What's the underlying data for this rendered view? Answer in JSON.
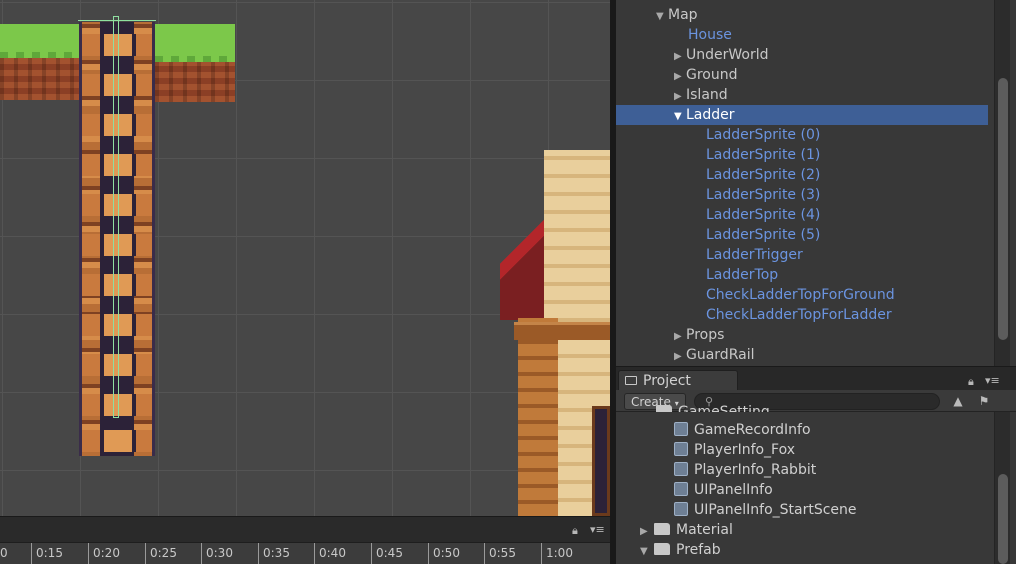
{
  "hierarchy": {
    "rows": [
      {
        "label": "Map"
      },
      {
        "label": "House"
      },
      {
        "label": "UnderWorld"
      },
      {
        "label": "Ground"
      },
      {
        "label": "Island"
      },
      {
        "label": "Ladder"
      },
      {
        "label": "LadderSprite (0)"
      },
      {
        "label": "LadderSprite (1)"
      },
      {
        "label": "LadderSprite (2)"
      },
      {
        "label": "LadderSprite (3)"
      },
      {
        "label": "LadderSprite (4)"
      },
      {
        "label": "LadderSprite (5)"
      },
      {
        "label": "LadderTrigger"
      },
      {
        "label": "LadderTop"
      },
      {
        "label": "CheckLadderTopForGround"
      },
      {
        "label": "CheckLadderTopForLadder"
      },
      {
        "label": "Props"
      },
      {
        "label": "GuardRail"
      }
    ],
    "selected": "Ladder",
    "prefab_color": "#6b94e0",
    "selection_color": "#3e5f96"
  },
  "project": {
    "tab_label": "Project",
    "create_label": "Create",
    "search_placeholder": "",
    "partial_folder": "GameSetting",
    "assets": [
      {
        "label": "GameRecordInfo"
      },
      {
        "label": "PlayerInfo_Fox"
      },
      {
        "label": "PlayerInfo_Rabbit"
      },
      {
        "label": "UIPanelInfo"
      },
      {
        "label": "UIPanelInfo_StartScene"
      }
    ],
    "folders": [
      {
        "label": "Material",
        "expanded": false
      },
      {
        "label": "Prefab",
        "expanded": true
      }
    ]
  },
  "timeline": {
    "ticks": [
      "0",
      "0:15",
      "0:20",
      "0:25",
      "0:30",
      "0:35",
      "0:40",
      "0:45",
      "0:50",
      "0:55",
      "1:00"
    ]
  },
  "icons": {
    "expanded": "triangle-down",
    "collapsed": "triangle-right",
    "lock": "lock-icon",
    "menu": "panel-menu-icon",
    "search": "search-icon",
    "filter_type": "type-filter-icon",
    "filter_label": "label-filter-icon"
  }
}
